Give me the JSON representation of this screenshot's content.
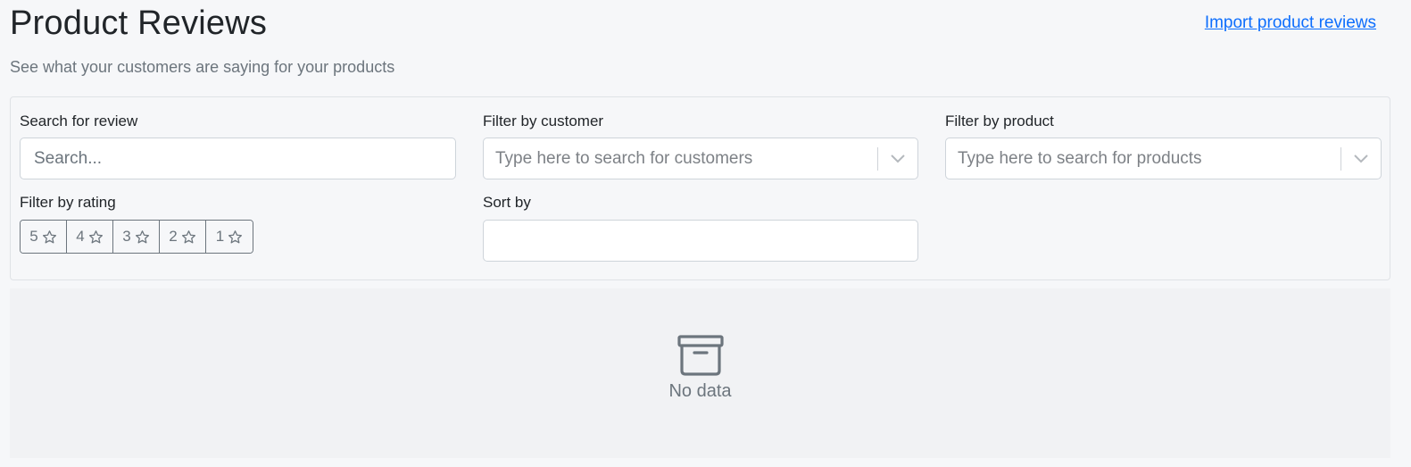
{
  "header": {
    "title": "Product Reviews",
    "subtitle": "See what your customers are saying for your products",
    "import_link": "Import product reviews"
  },
  "filters": {
    "search": {
      "label": "Search for review",
      "placeholder": "Search...",
      "value": ""
    },
    "customer": {
      "label": "Filter by customer",
      "placeholder": "Type here to search for customers",
      "icon": "chevron-down-icon"
    },
    "product": {
      "label": "Filter by product",
      "placeholder": "Type here to search for products",
      "icon": "chevron-down-icon"
    },
    "rating": {
      "label": "Filter by rating",
      "options": [
        {
          "value": "5",
          "icon": "star-outline-icon"
        },
        {
          "value": "4",
          "icon": "star-outline-icon"
        },
        {
          "value": "3",
          "icon": "star-outline-icon"
        },
        {
          "value": "2",
          "icon": "star-outline-icon"
        },
        {
          "value": "1",
          "icon": "star-outline-icon"
        }
      ]
    },
    "sort": {
      "label": "Sort by",
      "value": ""
    }
  },
  "empty_state": {
    "icon": "archive-box-icon",
    "text": "No data"
  },
  "colors": {
    "link": "#0d6efd",
    "muted": "#6c757d",
    "panel_bg": "#f6f7f9",
    "border": "#ced4da"
  }
}
